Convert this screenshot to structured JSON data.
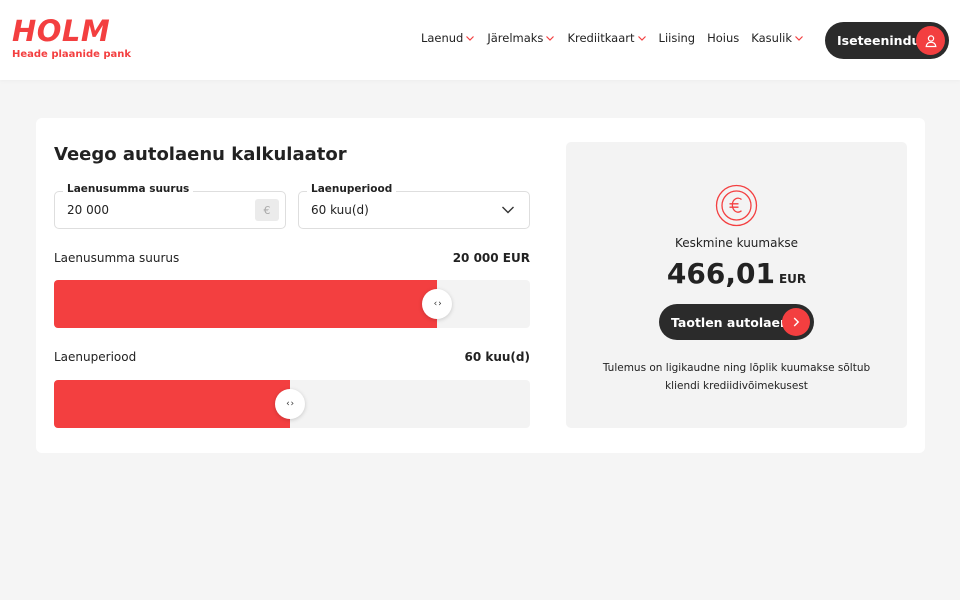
{
  "brand": {
    "name": "HOLM",
    "tagline": "Heade plaanide pank",
    "accent_color": "#f33f40",
    "dark_color": "#2b2b2b"
  },
  "nav": {
    "items": [
      {
        "label": "Laenud",
        "has_dropdown": true
      },
      {
        "label": "Järelmaks",
        "has_dropdown": true
      },
      {
        "label": "Krediitkaart",
        "has_dropdown": true
      },
      {
        "label": "Liising",
        "has_dropdown": false
      },
      {
        "label": "Hoius",
        "has_dropdown": false
      },
      {
        "label": "Kasulik",
        "has_dropdown": true
      }
    ],
    "self_service_label": "Iseteenindus",
    "self_service_icon": "user-icon"
  },
  "calculator": {
    "title": "Veego autolaenu kalkulaator",
    "amount_field": {
      "label": "Laenusumma suurus",
      "value": "20 000",
      "unit_icon": "€"
    },
    "period_field": {
      "label": "Laenuperiood",
      "value": "60 kuu(d)"
    },
    "amount_slider": {
      "label": "Laenusumma suurus",
      "value_text": "20 000 EUR",
      "fill_percent": 80.5,
      "thumb_glyph": "‹ ›"
    },
    "period_slider": {
      "label": "Laenuperiood",
      "value_text": "60 kuu(d)",
      "fill_percent": 49.5,
      "thumb_glyph": "‹ ›"
    }
  },
  "result": {
    "icon": "euro-icon",
    "label": "Keskmine kuumakse",
    "amount": "466,01",
    "currency": "EUR",
    "apply_label": "Taotlen autolaenu",
    "disclaimer": "Tulemus on ligikaudne ning lõplik kuumakse sõltub kliendi krediidivõimekusest"
  }
}
